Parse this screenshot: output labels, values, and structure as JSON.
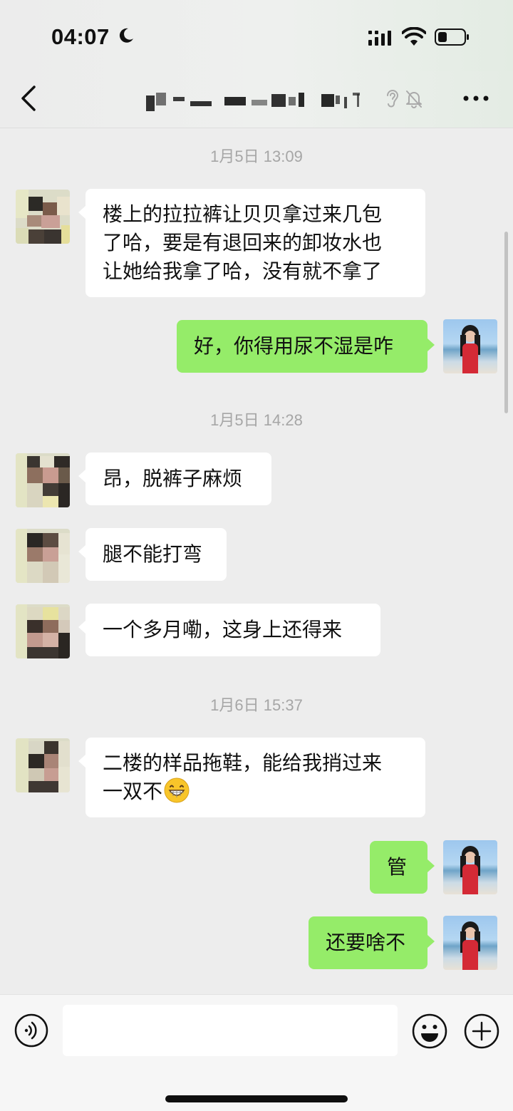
{
  "status_bar": {
    "time": "04:07"
  },
  "chat": {
    "title": "",
    "timestamps": [
      "1月5日 13:09",
      "1月5日 14:28",
      "1月6日 15:37"
    ],
    "messages": [
      {
        "side": "left",
        "lines": [
          "楼上的拉拉裤让贝贝拿过来几包",
          "了哈，要是有退回来的卸妆水也",
          "让她给我拿了哈，没有就不拿了"
        ]
      },
      {
        "side": "right",
        "text": "好，你得用尿不湿是咋"
      },
      {
        "side": "left",
        "text": "昂，脱裤子麻烦"
      },
      {
        "side": "left",
        "text": "腿不能打弯"
      },
      {
        "side": "left",
        "text": "一个多月嘞，这身上还得来"
      },
      {
        "side": "left",
        "lines": [
          "二楼的样品拖鞋，能给我捎过来",
          "一双不"
        ],
        "emoji": "grinning-face"
      },
      {
        "side": "right",
        "text": "管"
      },
      {
        "side": "right",
        "text": "还要啥不"
      }
    ]
  },
  "icons": {
    "back": "chevron-left-icon",
    "ear": "ear-icon",
    "mute": "bell-muted-icon",
    "more": "more-dots-icon",
    "voice": "voice-icon",
    "emoji": "smiley-icon",
    "plus": "plus-circle-icon"
  },
  "colors": {
    "self_bubble": "#95ec69",
    "other_bubble": "#ffffff",
    "background": "#ededed"
  }
}
